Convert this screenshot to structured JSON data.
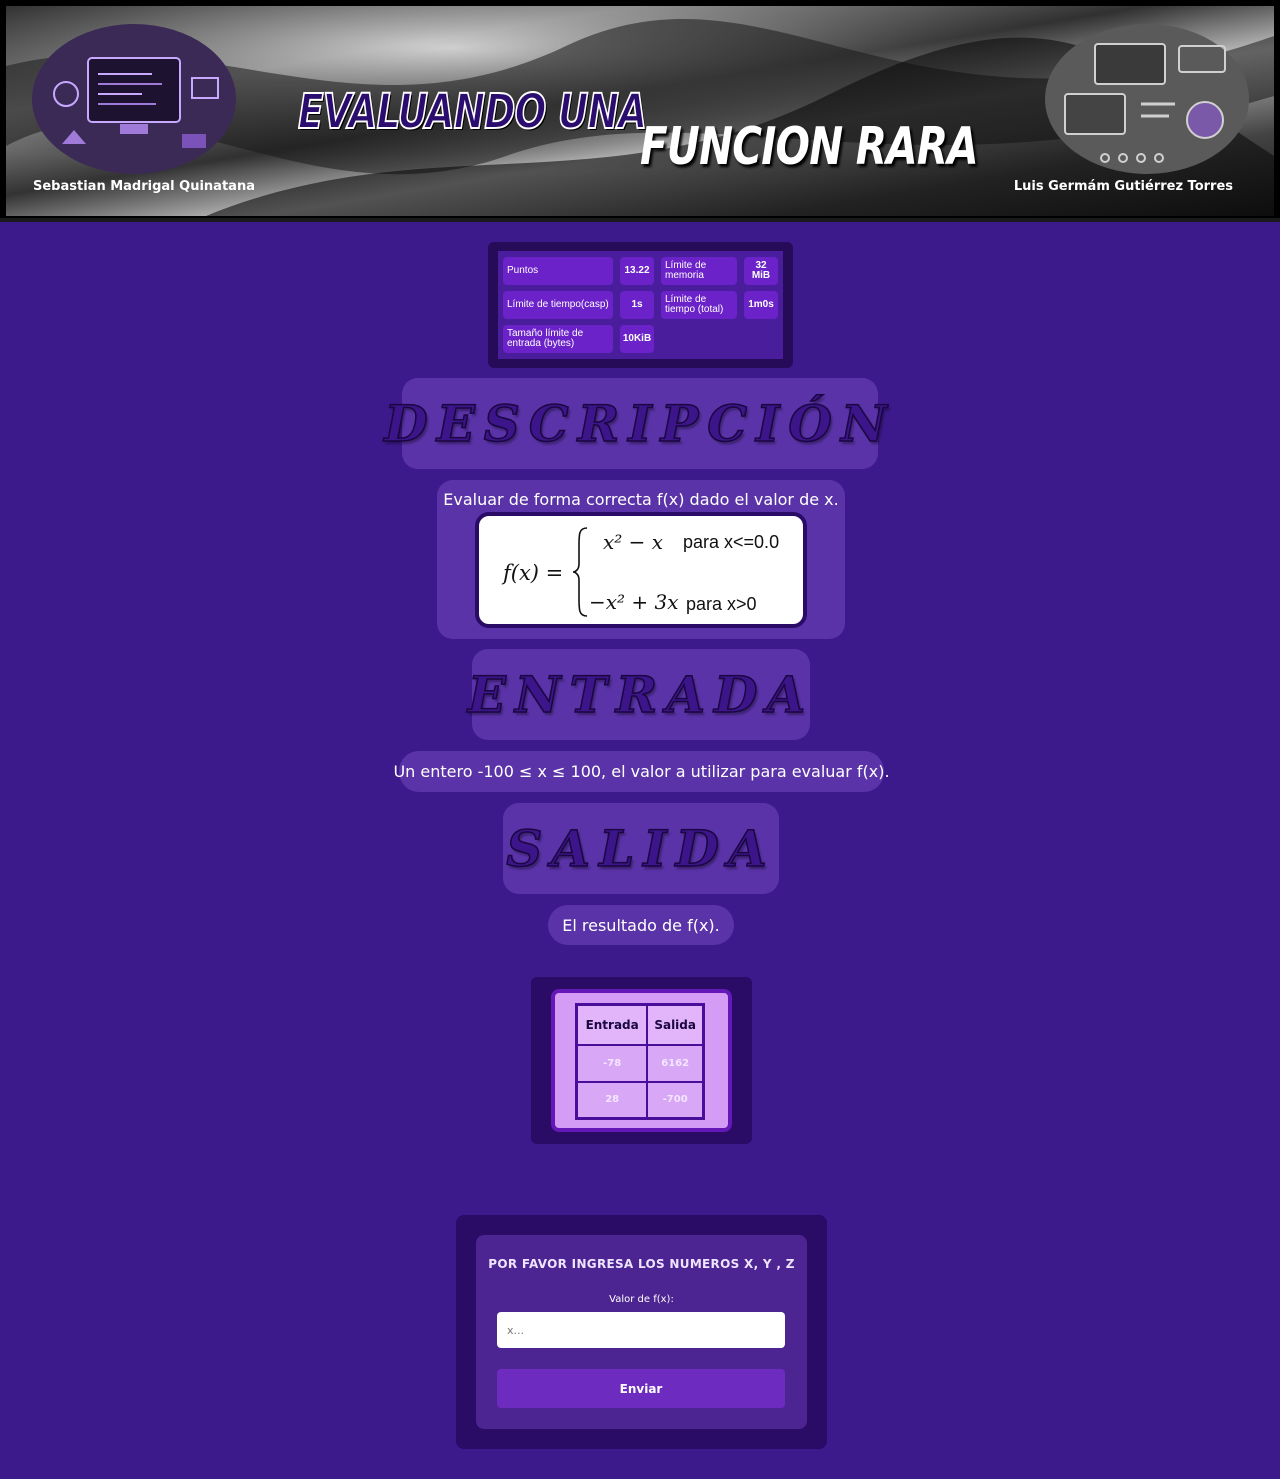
{
  "header": {
    "title_line1": "EVALUANDO UNA",
    "title_line2": "FUNCION RARA",
    "author_left": "Sebastian Madrigal Quinatana",
    "author_right": "Luis Germám Gutiérrez Torres"
  },
  "stats": [
    {
      "label": "Puntos",
      "value": "13.22"
    },
    {
      "label": "Límite de memoria",
      "value": "32 MiB"
    },
    {
      "label": "Límite de tiempo(casp)",
      "value": "1s"
    },
    {
      "label": "Límite de tiempo (total)",
      "value": "1m0s"
    },
    {
      "label": "Tamaño límite de entrada (bytes)",
      "value": "10KiB"
    }
  ],
  "sections": {
    "descripcion": "DESCRIPCIÓN",
    "entrada": "ENTRADA",
    "salida": "SALIDA"
  },
  "descripcion": {
    "text": "Evaluar de forma correcta f(x) dado el valor de x.",
    "formula": {
      "lhs": "f(x) =",
      "case1_expr": "x² − x",
      "case1_cond": "para x<=0.0",
      "case2_expr": "−x² + 3x",
      "case2_cond": "para x>0"
    }
  },
  "entrada_text": "Un entero -100 ≤ x ≤ 100, el valor a utilizar para evaluar f(x).",
  "salida_text": "El resultado de f(x).",
  "examples": {
    "headers": [
      "Entrada",
      "Salida"
    ],
    "rows": [
      [
        "-78",
        "6162"
      ],
      [
        "28",
        "-700"
      ]
    ]
  },
  "form": {
    "title": "POR FAVOR INGRESA LOS NUMEROS X, Y , Z",
    "label": "Valor de f(x):",
    "placeholder": "x...",
    "button": "Enviar"
  }
}
